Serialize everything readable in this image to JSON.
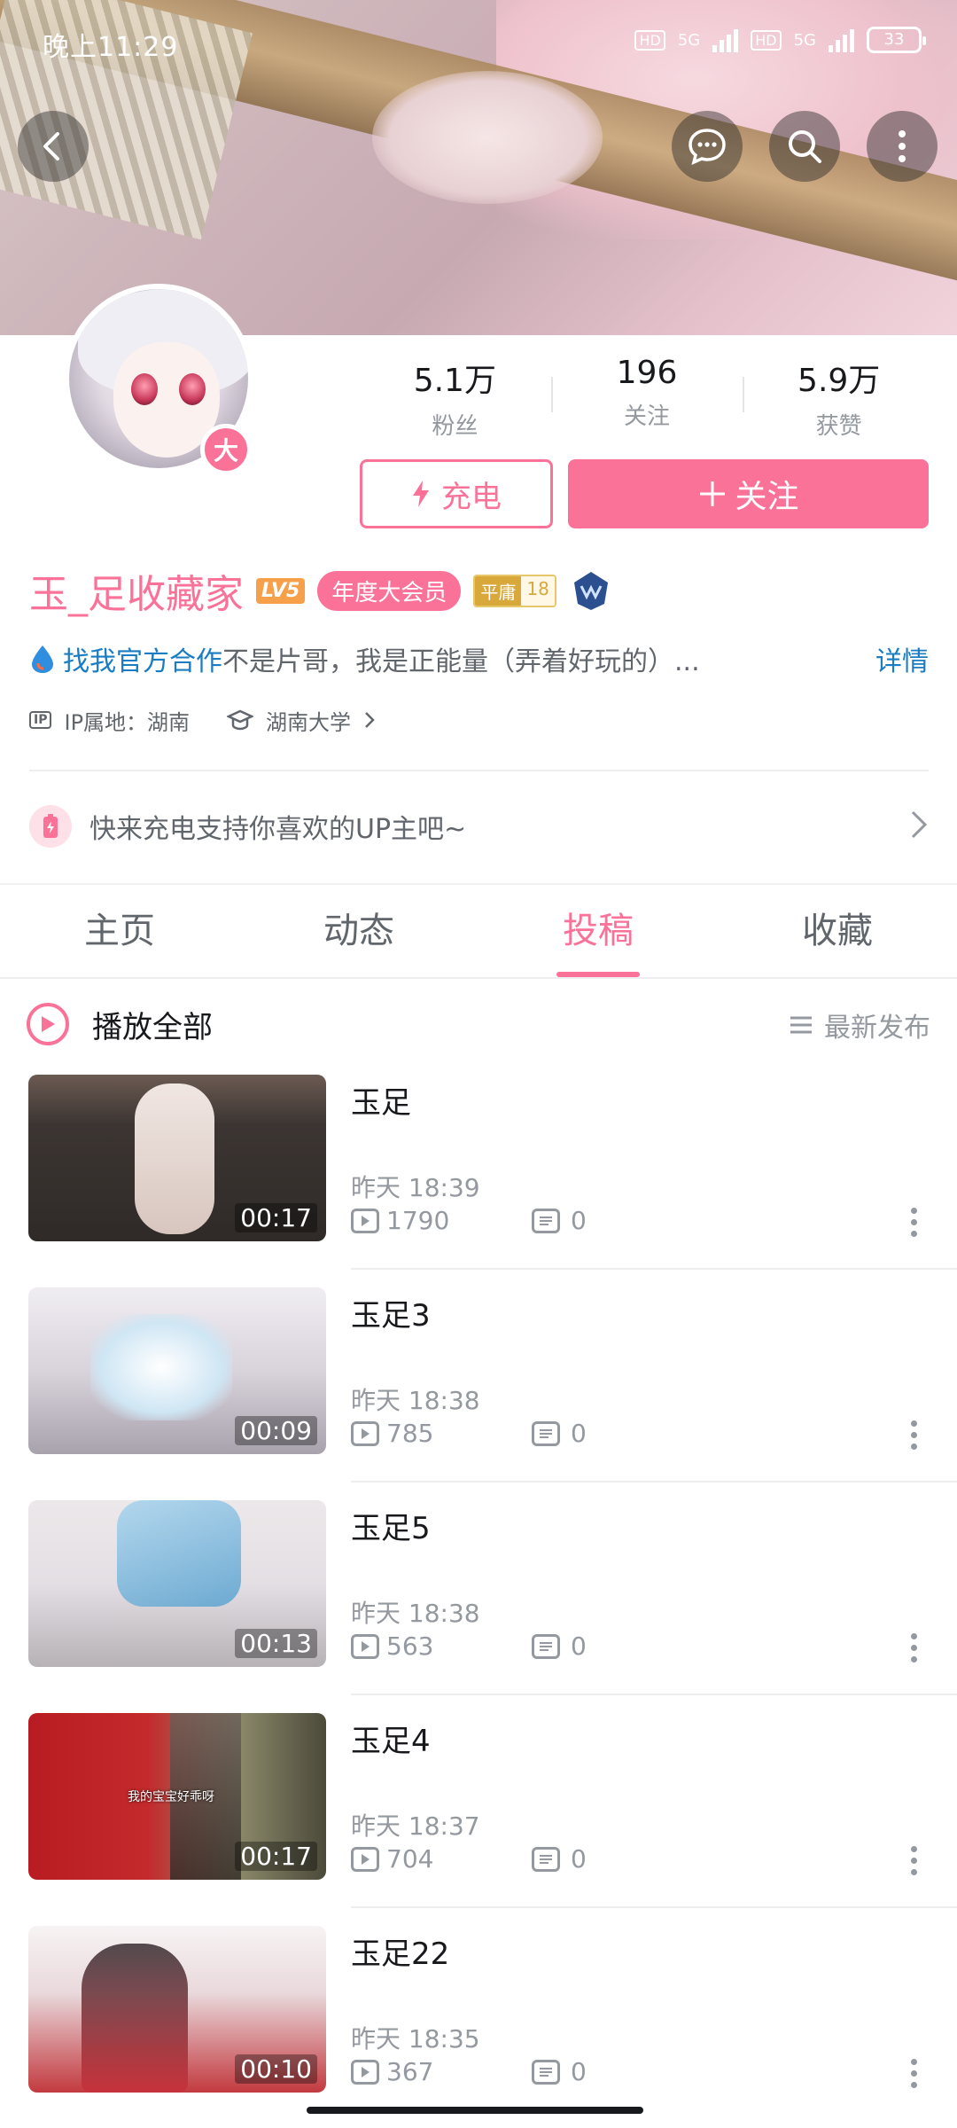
{
  "status_bar": {
    "time": "晚上11:29",
    "hd1": "HD",
    "net1": "5G",
    "hd2": "HD",
    "net2": "5G",
    "battery": "33"
  },
  "header": {
    "icons": [
      "back-icon",
      "chat-bubble-icon",
      "search-icon",
      "more-vertical-icon"
    ]
  },
  "profile": {
    "avatar_badge": "大",
    "stats": [
      {
        "value": "5.1万",
        "label": "粉丝"
      },
      {
        "value": "196",
        "label": "关注"
      },
      {
        "value": "5.9万",
        "label": "获赞"
      }
    ],
    "charge_label": "充电",
    "follow_label": "关注",
    "username": "玉_足收藏家",
    "level": "LV5",
    "vip_label": "年度大会员",
    "rank_a": "平庸",
    "rank_b": "18",
    "official_label": "找我官方合作",
    "bio": "不是片哥，我是正能量（弄着好玩的）...",
    "detail_label": "详情",
    "ip_tag": "IP",
    "ip_location": "IP属地：湖南",
    "school": "湖南大学"
  },
  "charge_banner": {
    "text": "快来充电支持你喜欢的UP主吧~"
  },
  "tabs": [
    {
      "label": "主页",
      "active": false
    },
    {
      "label": "动态",
      "active": false
    },
    {
      "label": "投稿",
      "active": true
    },
    {
      "label": "收藏",
      "active": false
    }
  ],
  "list_header": {
    "play_all": "播放全部",
    "sort": "最新发布"
  },
  "videos": [
    {
      "title": "玉足",
      "duration": "00:17",
      "date": "昨天 18:39",
      "plays": "1790",
      "comments": "0"
    },
    {
      "title": "玉足3",
      "duration": "00:09",
      "date": "昨天 18:38",
      "plays": "785",
      "comments": "0"
    },
    {
      "title": "玉足5",
      "duration": "00:13",
      "date": "昨天 18:38",
      "plays": "563",
      "comments": "0"
    },
    {
      "title": "玉足4",
      "duration": "00:17",
      "date": "昨天 18:37",
      "plays": "704",
      "comments": "0",
      "thumb_caption": "我的宝宝好乖呀"
    },
    {
      "title": "玉足22",
      "duration": "00:10",
      "date": "昨天 18:35",
      "plays": "367",
      "comments": "0"
    }
  ],
  "colors": {
    "accent": "#fb7299",
    "link": "#1a7cc2",
    "muted": "#9499a0"
  }
}
